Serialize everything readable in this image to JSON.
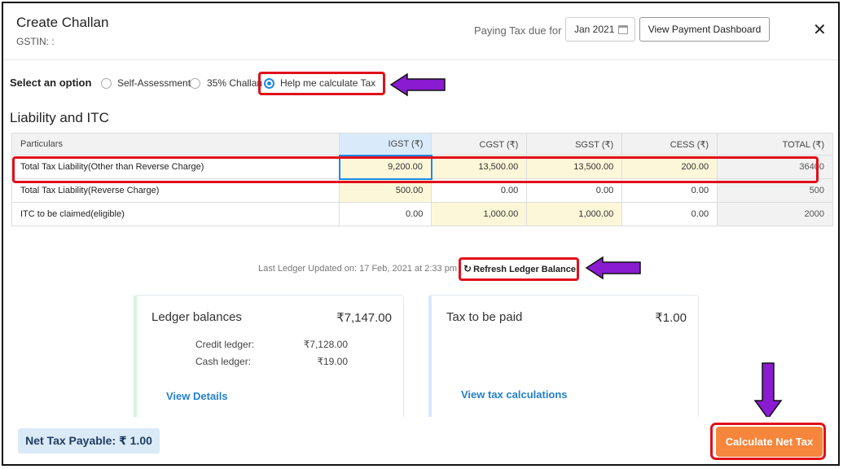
{
  "header": {
    "title": "Create Challan",
    "gstin": "GSTIN: :",
    "due_label": "Paying Tax due for",
    "month": "Jan 2021",
    "dashboard_button": "View Payment Dashboard",
    "close": "✕"
  },
  "options": {
    "label": "Select an option",
    "items": [
      {
        "label": "Self-Assessment",
        "checked": false
      },
      {
        "label": "35% Challan",
        "checked": false
      },
      {
        "label": "Help me calculate Tax",
        "checked": true
      }
    ]
  },
  "section_title": "Liability and ITC",
  "table": {
    "headers": [
      "Particulars",
      "IGST (₹)",
      "CGST (₹)",
      "SGST (₹)",
      "CESS (₹)",
      "TOTAL (₹)"
    ],
    "rows": [
      {
        "label": "Total Tax Liability(Other than Reverse Charge)",
        "igst": "9,200.00",
        "cgst": "13,500.00",
        "sgst": "13,500.00",
        "cess": "200.00",
        "total": "36400"
      },
      {
        "label": "Total Tax Liability(Reverse Charge)",
        "igst": "500.00",
        "cgst": "0.00",
        "sgst": "0.00",
        "cess": "0.00",
        "total": "500"
      },
      {
        "label": "ITC to be claimed(eligible)",
        "igst": "0.00",
        "cgst": "1,000.00",
        "sgst": "1,000.00",
        "cess": "0.00",
        "total": "2000"
      }
    ]
  },
  "ledger": {
    "updated": "Last Ledger Updated on: 17 Feb, 2021 at 2:33 pm",
    "refresh": "Refresh Ledger Balance"
  },
  "ledger_card": {
    "title": "Ledger balances",
    "amount": "₹7,147.00",
    "credit_label": "Credit ledger:",
    "credit_value": "₹7,128.00",
    "cash_label": "Cash ledger:",
    "cash_value": "₹19.00",
    "link": "View Details"
  },
  "tax_card": {
    "title": "Tax to be paid",
    "amount": "₹1.00",
    "link": "View tax calculations"
  },
  "footer": {
    "net_tax": "Net Tax Payable: ₹ 1.00",
    "calc_button": "Calculate Net Tax"
  },
  "colors": {
    "highlight": "#e0101a",
    "annotation_arrow": "#8a1bd1",
    "accent": "#1e88e5",
    "calc_button": "#f5863c"
  }
}
